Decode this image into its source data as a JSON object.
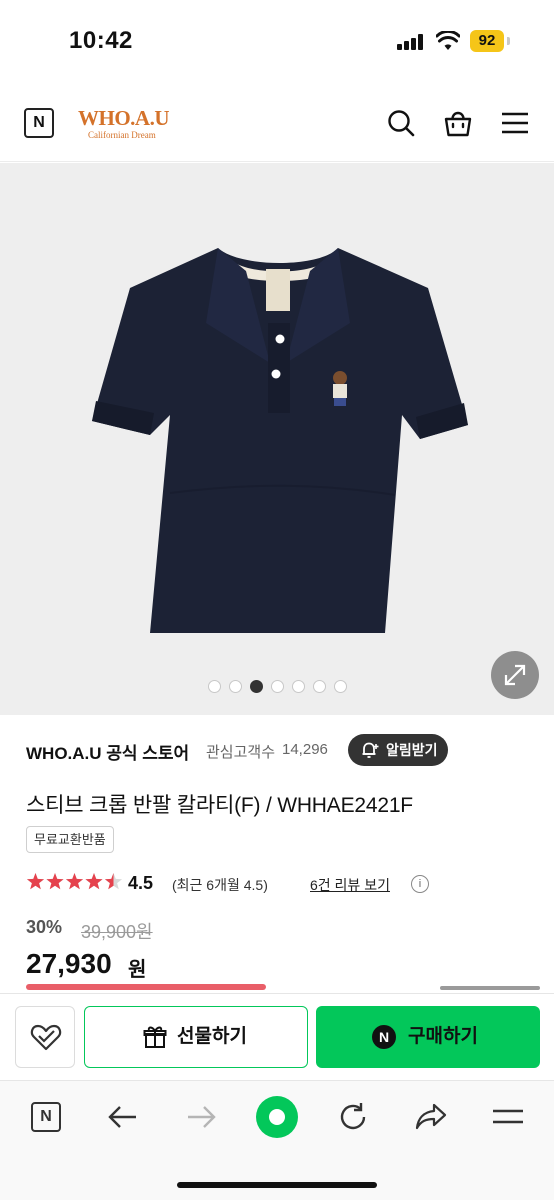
{
  "status_bar": {
    "time": "10:42",
    "battery": "92"
  },
  "header": {
    "naver_logo": "N",
    "brand_name": "WHO.A.U",
    "brand_sub": "Californian Dream",
    "icons": [
      "search-icon",
      "shopping-bag-icon",
      "menu-icon"
    ]
  },
  "gallery": {
    "image": "navy polo shirt with embroidered bear logo",
    "dot_count": 7,
    "active_index": 2
  },
  "store": {
    "name": "WHO.A.U 공식 스토어",
    "followers_label": "관심고객수",
    "followers_count": "14,296",
    "alert_button": "알림받기"
  },
  "product": {
    "title": "스티브 크롭 반팔 칼라티(F) / WHHAE2421F",
    "tag": "무료교환반품",
    "rating": "4.5",
    "rating_stars": 4.5,
    "rating_recent": "(최근 6개월 4.5)",
    "review_link": "6건 리뷰 보기",
    "discount": "30%",
    "original_price": "39,900원",
    "price": "27,930",
    "price_unit": "원"
  },
  "actions": {
    "gift_label": "선물하기",
    "buy_label": "구매하기",
    "buy_icon_text": "N"
  },
  "browser": {
    "n_label": "N"
  },
  "colors": {
    "naver_green": "#03c75a",
    "brand_orange": "#d4722a",
    "star_red": "#e5424d",
    "shirt_navy": "#1c2235"
  }
}
